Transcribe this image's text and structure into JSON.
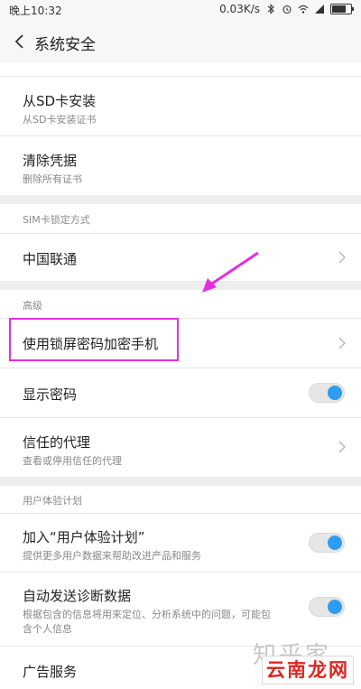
{
  "status": {
    "time": "晚上10:32",
    "speed": "0.03K/s"
  },
  "header": {
    "title": "系统安全"
  },
  "items": {
    "sd_install": {
      "title": "从SD卡安装",
      "subtitle": "从SD卡安装证书"
    },
    "clear_creds": {
      "title": "清除凭据",
      "subtitle": "删除所有证书"
    },
    "carrier": {
      "title": "中国联通"
    },
    "encrypt": {
      "title": "使用锁屏密码加密手机"
    },
    "show_pwd": {
      "title": "显示密码",
      "on": true
    },
    "trust_agent": {
      "title": "信任的代理",
      "subtitle": "查看或停用信任的代理"
    },
    "join_ux": {
      "title": "加入“用户体验计划”",
      "subtitle": "提供更多用户数据来帮助改进产品和服务",
      "on": true
    },
    "auto_diag": {
      "title": "自动发送诊断数据",
      "subtitle1": "根据包含的信息将用来定位、分析系统中的问题，可能包",
      "subtitle2": "含个人信息",
      "on": true
    },
    "ads": {
      "title": "广告服务"
    }
  },
  "sections": {
    "sim_lock": "SIM卡锁定方式",
    "advanced": "高级",
    "ux_plan": "用户体验计划"
  },
  "watermark": {
    "text": "知乎家",
    "stamp": "云南龙网"
  },
  "colors": {
    "accent": "#2e9cf0",
    "highlight": "#e52ee0"
  }
}
